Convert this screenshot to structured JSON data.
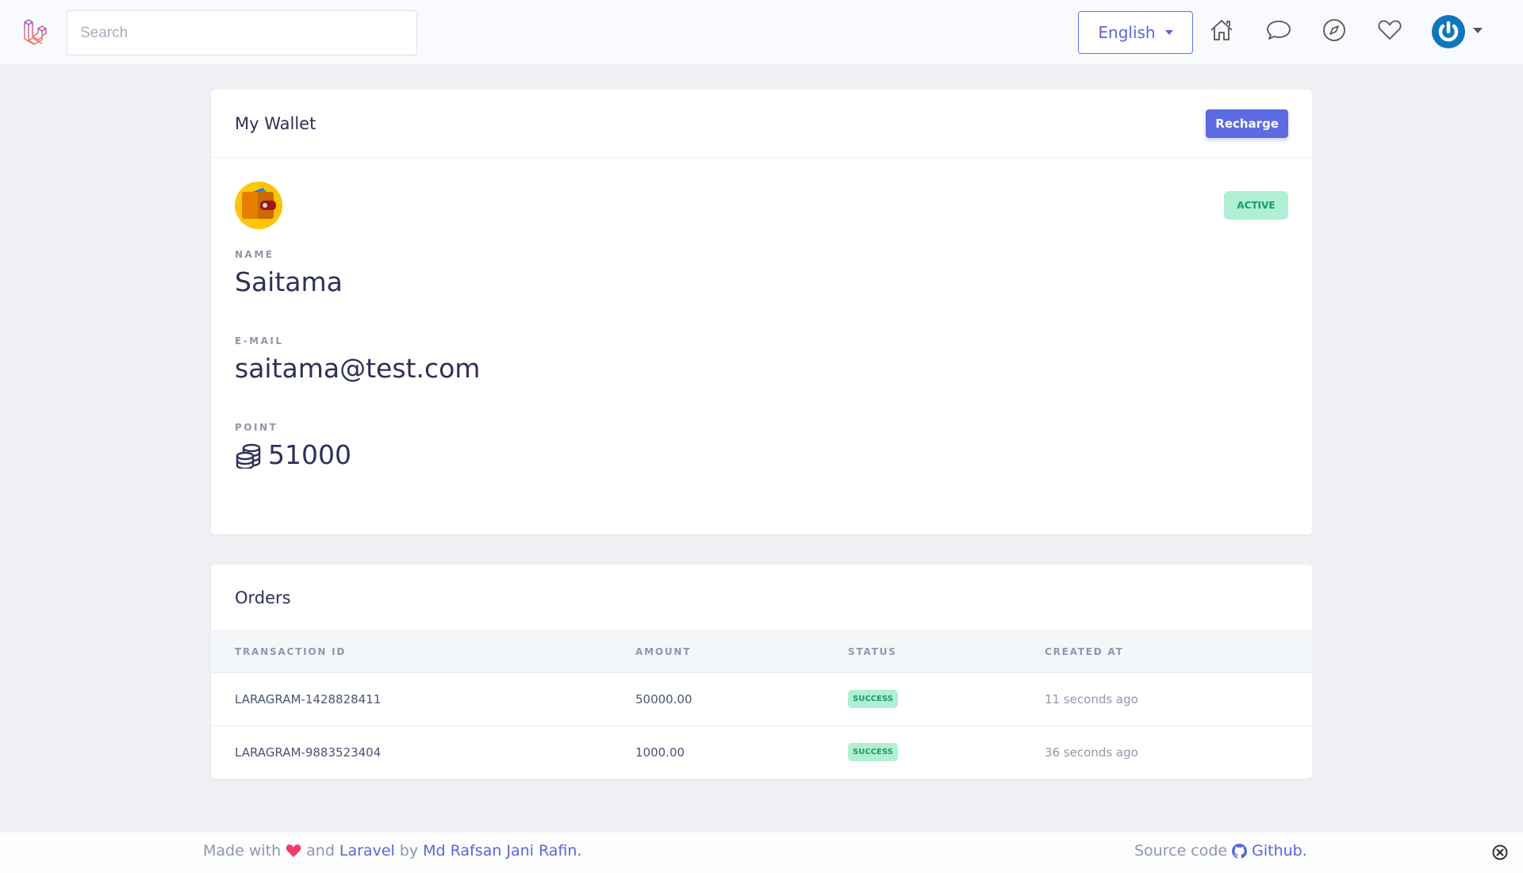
{
  "navbar": {
    "logo_icon": "laravel-logo-icon",
    "search": {
      "placeholder": "Search",
      "value": ""
    },
    "language": {
      "selected": "English"
    },
    "icons": [
      "home-icon",
      "chat-bubble-icon",
      "compass-icon",
      "heart-icon"
    ],
    "avatar_icon": "power-avatar-icon"
  },
  "wallet": {
    "title": "My Wallet",
    "recharge_label": "Recharge",
    "status": "ACTIVE",
    "wallet_icon": "wallet-icon",
    "fields": {
      "name_label": "NAME",
      "name_value": "Saitama",
      "email_label": "E-MAIL",
      "email_value": "saitama@test.com",
      "point_label": "POINT",
      "point_value": "51000",
      "point_icon": "coins-icon"
    }
  },
  "orders": {
    "title": "Orders",
    "columns": [
      "TRANSACTION ID",
      "AMOUNT",
      "STATUS",
      "CREATED AT"
    ],
    "rows": [
      {
        "transaction_id": "LARAGRAM-1428828411",
        "amount": "50000.00",
        "status": "SUCCESS",
        "created_at": "11 seconds ago"
      },
      {
        "transaction_id": "LARAGRAM-9883523404",
        "amount": "1000.00",
        "status": "SUCCESS",
        "created_at": "36 seconds ago"
      }
    ]
  },
  "footer": {
    "made_with": "Made with",
    "and": "and",
    "laravel_link": "Laravel",
    "by": "by",
    "author_link": "Md Rafsan Jani Rafin.",
    "source_code": "Source code",
    "github_link": "Github."
  },
  "colors": {
    "accent": "#5c6bdf",
    "success_bg": "#b0efd3",
    "success_text": "#1b9b66",
    "heart": "#f53b6a"
  }
}
